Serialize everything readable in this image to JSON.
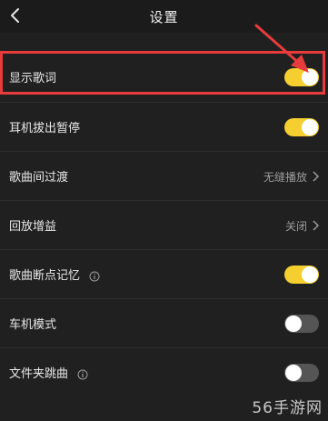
{
  "header": {
    "title": "设置",
    "back_icon": "chevron-left-icon"
  },
  "settings": {
    "show_lyrics": {
      "label": "显示歌词",
      "state": "on"
    },
    "headphone_pause": {
      "label": "耳机拔出暂停",
      "state": "on"
    },
    "crossfade": {
      "label": "歌曲间过渡",
      "value": "无缝播放"
    },
    "replay_gain": {
      "label": "回放增益",
      "value": "关闭"
    },
    "resume_playback": {
      "label": "歌曲断点记忆",
      "state": "on",
      "info_icon": "info-icon"
    },
    "car_mode": {
      "label": "车机模式",
      "state": "off"
    },
    "folder_skip": {
      "label": "文件夹跳曲",
      "state": "off",
      "info_icon": "info-icon"
    }
  },
  "annotation": {
    "highlight_color": "#e83b3b",
    "arrow_color": "#e83b3b"
  },
  "colors": {
    "toggle_on": "#f4cf2f",
    "toggle_off": "#555555",
    "background": "#202020"
  },
  "watermark": "56手游网"
}
